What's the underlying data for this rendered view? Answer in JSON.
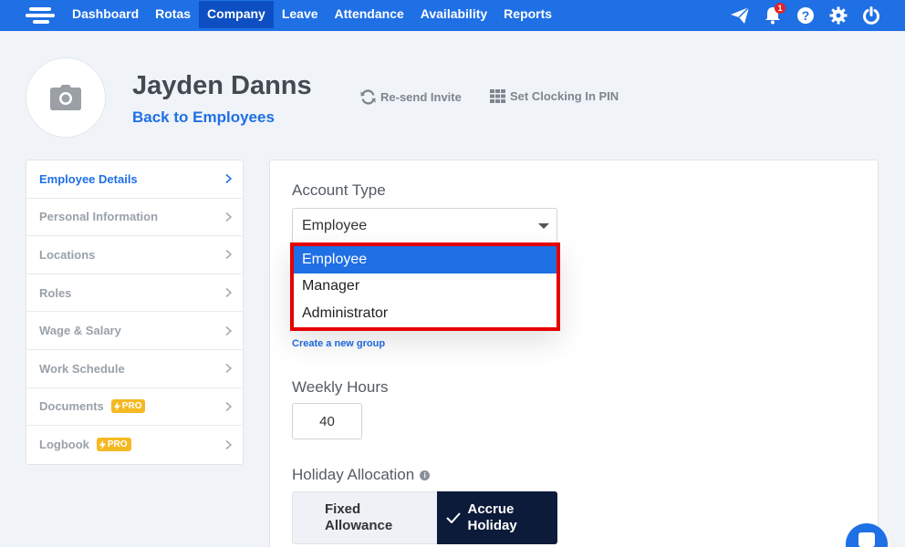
{
  "nav": {
    "items": [
      {
        "label": "Dashboard",
        "active": false
      },
      {
        "label": "Rotas",
        "active": false
      },
      {
        "label": "Company",
        "active": true
      },
      {
        "label": "Leave",
        "active": false
      },
      {
        "label": "Attendance",
        "active": false
      },
      {
        "label": "Availability",
        "active": false
      },
      {
        "label": "Reports",
        "active": false
      }
    ],
    "notification_count": "1",
    "icons": [
      "send-icon",
      "bell-icon",
      "help-icon",
      "gear-icon",
      "power-icon"
    ]
  },
  "header": {
    "name": "Jayden Danns",
    "back_link": "Back to Employees",
    "resend_invite": "Re-send Invite",
    "set_pin": "Set Clocking In PIN"
  },
  "sidebar": {
    "items": [
      {
        "label": "Employee Details",
        "active": true,
        "pro": false
      },
      {
        "label": "Personal Information",
        "active": false,
        "pro": false
      },
      {
        "label": "Locations",
        "active": false,
        "pro": false
      },
      {
        "label": "Roles",
        "active": false,
        "pro": false
      },
      {
        "label": "Wage & Salary",
        "active": false,
        "pro": false
      },
      {
        "label": "Work Schedule",
        "active": false,
        "pro": false
      },
      {
        "label": "Documents",
        "active": false,
        "pro": true
      },
      {
        "label": "Logbook",
        "active": false,
        "pro": true
      }
    ],
    "pro_label": "PRO"
  },
  "form": {
    "account_type_label": "Account Type",
    "account_type_value": "Employee",
    "account_type_options": [
      "Employee",
      "Manager",
      "Administrator"
    ],
    "create_group_link": "Create a new group",
    "weekly_hours_label": "Weekly Hours",
    "weekly_hours_value": "40",
    "holiday_label": "Holiday Allocation",
    "holiday_options": [
      {
        "line1": "Fixed",
        "line2": "Allowance",
        "selected": false
      },
      {
        "line1": "Accrue",
        "line2": "Holiday",
        "selected": true
      }
    ]
  },
  "colors": {
    "brand": "#1f6fe5",
    "highlight_border": "#e60000",
    "selected_toggle": "#0c1b3a",
    "pro_badge": "#f4b923"
  }
}
